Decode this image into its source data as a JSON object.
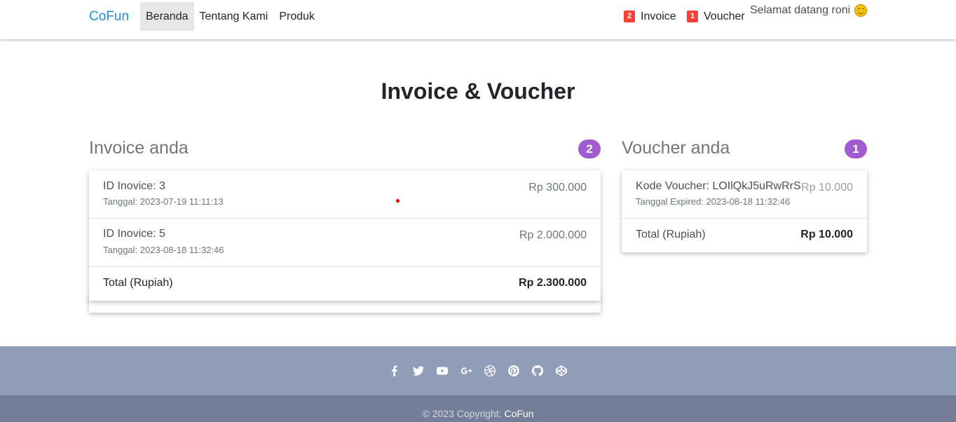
{
  "navbar": {
    "brand": "CoFun",
    "links": [
      {
        "label": "Beranda"
      },
      {
        "label": "Tentang Kami"
      },
      {
        "label": "Produk"
      }
    ],
    "invoice_count": "2",
    "invoice_label": "Invoice",
    "voucher_count": "1",
    "voucher_label": "Voucher",
    "greeting": "Selamat datang roni"
  },
  "page": {
    "title": "Invoice & Voucher"
  },
  "invoice_section": {
    "heading": "Invoice anda",
    "count": "2",
    "items": [
      {
        "title": "ID Inovice: 3",
        "date": "Tanggal: 2023-07-19 11:11:13",
        "price": "Rp 300.000"
      },
      {
        "title": "ID Inovice: 5",
        "date": "Tanggal: 2023-08-18 11:32:46",
        "price": "Rp 2.000.000"
      }
    ],
    "total_label": "Total (Rupiah)",
    "total_value": "Rp 2.300.000"
  },
  "voucher_section": {
    "heading": "Voucher anda",
    "count": "1",
    "items": [
      {
        "title": "Kode Voucher: LOIlQkJ5uRwRrS",
        "date": "Tanggal Expired: 2023-08-18 11:32:46",
        "price": "Rp 10.000"
      }
    ],
    "total_label": "Total (Rupiah)",
    "total_value": "Rp 10.000"
  },
  "footer": {
    "social_icons": [
      "facebook-icon",
      "twitter-icon",
      "youtube-icon",
      "google-plus-icon",
      "dribbble-icon",
      "pinterest-icon",
      "github-icon",
      "codepen-icon"
    ],
    "copyright_prefix": "© 2023 Copyright: ",
    "copyright_brand": "CoFun"
  },
  "colors": {
    "brand": "#1a8fe3",
    "badge_red": "#f44336",
    "badge_purple": "#a05bd1",
    "footer_top": "#8f9db9",
    "footer_bottom": "#737f98"
  }
}
